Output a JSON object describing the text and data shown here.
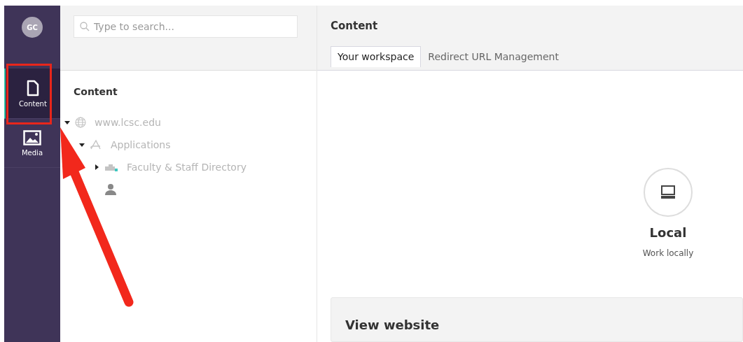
{
  "sidebar": {
    "avatar": "GC",
    "sections": [
      {
        "label": "Content",
        "kind": "document",
        "selected": true
      },
      {
        "label": "Media",
        "kind": "image",
        "selected": false
      }
    ]
  },
  "tree_panel": {
    "search": {
      "placeholder": "Type to search..."
    },
    "title": "Content",
    "tree": [
      {
        "label": "www.lcsc.edu",
        "kind": "globe",
        "expanded": true,
        "children": [
          {
            "label": "Applications",
            "kind": "app",
            "expanded": true,
            "children": [
              {
                "label": "Faculty & Staff Directory",
                "kind": "building",
                "expanded": false
              },
              {
                "kind": "person"
              }
            ]
          }
        ]
      }
    ]
  },
  "main": {
    "title": "Content",
    "tabs": [
      {
        "label": "Your workspace",
        "selected": true
      },
      {
        "label": "Redirect URL Management",
        "selected": false
      }
    ],
    "workspace": {
      "name": "Local",
      "description": "Work locally"
    },
    "card": {
      "title": "View website"
    }
  },
  "annotation": {
    "highlight": true,
    "arrow": true
  }
}
